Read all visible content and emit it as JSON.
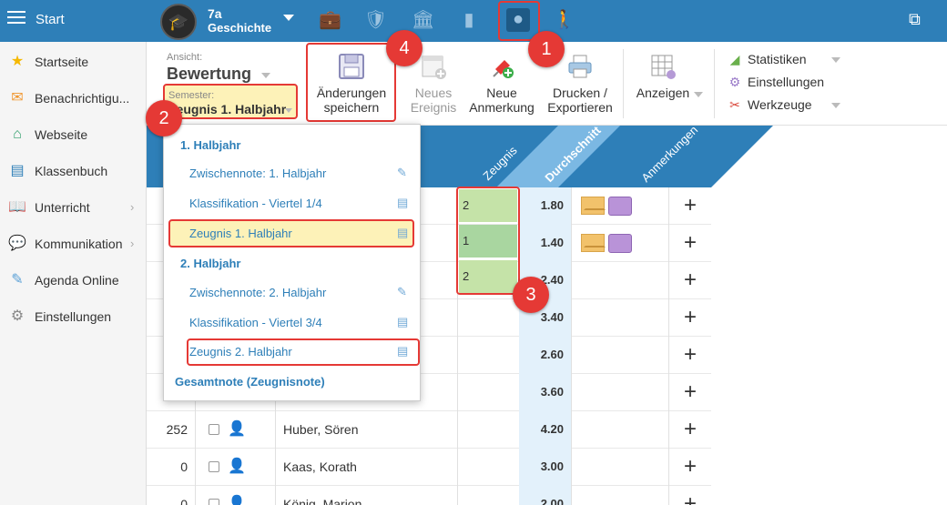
{
  "topbar": {
    "start_label": "Start",
    "class_name": "7a",
    "class_subject": "Geschichte",
    "icons": [
      "briefcase-icon",
      "shield-check-icon",
      "institution-icon",
      "bar-chart-icon",
      "grade-icon",
      "walking-icon"
    ],
    "cast_icon": "cast-icon"
  },
  "sidebar": {
    "items": [
      {
        "label": "Startseite",
        "icon": "star-icon",
        "has_arrow": false
      },
      {
        "label": "Benachrichtigu...",
        "icon": "mail-icon",
        "has_arrow": false
      },
      {
        "label": "Webseite",
        "icon": "home-icon",
        "has_arrow": false
      },
      {
        "label": "Klassenbuch",
        "icon": "book-icon",
        "has_arrow": false
      },
      {
        "label": "Unterricht",
        "icon": "open-book-icon",
        "has_arrow": true
      },
      {
        "label": "Kommunikation",
        "icon": "chat-icon",
        "has_arrow": true
      },
      {
        "label": "Agenda Online",
        "icon": "pen-icon",
        "has_arrow": false
      },
      {
        "label": "Einstellungen",
        "icon": "gear-icon",
        "has_arrow": false
      }
    ]
  },
  "toolbar": {
    "ansicht_label": "Ansicht:",
    "ansicht_value": "Bewertung",
    "semester_label": "Semester:",
    "semester_value": "Zeugnis 1. Halbjahr",
    "save_line1": "Änderungen",
    "save_line2": "speichern",
    "neues_line1": "Neues",
    "neues_line2": "Ereignis",
    "anm_line1": "Neue",
    "anm_line2": "Anmerkung",
    "druck_line1": "Drucken /",
    "druck_line2": "Exportieren",
    "anzeigen": "Anzeigen",
    "statistiken": "Statistiken",
    "einstellungen": "Einstellungen",
    "werkzeuge": "Werkzeuge"
  },
  "columns": {
    "zeugnis": "Zeugnis",
    "durchschnitt": "Durchschnitt",
    "anmerkungen": "Anmerkungen"
  },
  "rows": [
    {
      "num": "",
      "name": "",
      "zeugnis": "2",
      "avg": "1.80",
      "notes": true
    },
    {
      "num": "",
      "name": "",
      "zeugnis": "1",
      "avg": "1.40",
      "notes": true
    },
    {
      "num": "",
      "name": "",
      "zeugnis": "2",
      "avg": "2.40",
      "notes": false
    },
    {
      "num": "",
      "name": "",
      "zeugnis": "",
      "avg": "3.40",
      "notes": false
    },
    {
      "num": "",
      "name": "",
      "zeugnis": "",
      "avg": "2.60",
      "notes": false
    },
    {
      "num": "",
      "name": "",
      "zeugnis": "",
      "avg": "3.60",
      "notes": false
    },
    {
      "num": "252",
      "name": "Huber, Sören",
      "zeugnis": "",
      "avg": "4.20",
      "notes": false
    },
    {
      "num": "0",
      "name": "Kaas, Korath",
      "zeugnis": "",
      "avg": "3.00",
      "notes": false
    },
    {
      "num": "0",
      "name": "König, Marion",
      "zeugnis": "",
      "avg": "2.00",
      "notes": false
    }
  ],
  "dropdown": {
    "h1": "1. Halbjahr",
    "i1": "Zwischennote: 1. Halbjahr",
    "i2": "Klassifikation - Viertel 1/4",
    "i3": "Zeugnis 1. Halbjahr",
    "h2": "2. Halbjahr",
    "i4": "Zwischennote: 2. Halbjahr",
    "i5": "Klassifikation - Viertel 3/4",
    "i6": "Zeugnis 2. Halbjahr",
    "total": "Gesamtnote (Zeugnisnote)"
  },
  "badges": {
    "b1": "1",
    "b2": "2",
    "b3": "3",
    "b4": "4"
  },
  "colors": {
    "brand": "#2e7fb8",
    "highlight": "#e53935",
    "selection": "#fdf2b8",
    "grade_green": "#c5e3a8"
  }
}
